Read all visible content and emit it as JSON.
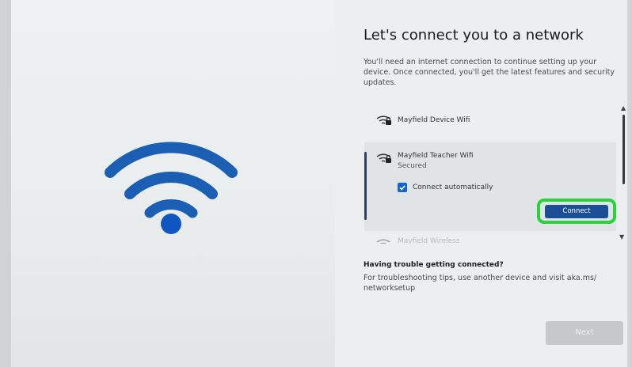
{
  "page": {
    "title": "Let's connect you to a network",
    "subtitle": "You'll need an internet connection to continue setting up your device. Once connected, you'll get the latest features and security updates."
  },
  "networks": [
    {
      "name": "Mayfield Device Wifi",
      "icon": "wifi-lock-icon"
    },
    {
      "name": "Mayfield Teacher Wifi",
      "status": "Secured",
      "icon": "wifi-lock-icon",
      "selected": true
    },
    {
      "name": "Mayfield Wireless",
      "icon": "wifi-icon",
      "partially_visible": true
    }
  ],
  "selected_network": {
    "auto_connect_label": "Connect automatically",
    "auto_connect_checked": true,
    "connect_label": "Connect"
  },
  "trouble": {
    "heading": "Having trouble getting connected?",
    "text": "For troubleshooting tips, use another device and visit aka.ms/ networksetup"
  },
  "footer": {
    "next_label": "Next",
    "next_enabled": false
  },
  "colors": {
    "wifi_hero": "#1a5fb4",
    "hero_dot": "#0f56c2",
    "connect_button": "#1b4e96",
    "highlight_outline": "#27d43a",
    "checkbox": "#0f67c6",
    "selected_accent": "#2f3e66"
  }
}
